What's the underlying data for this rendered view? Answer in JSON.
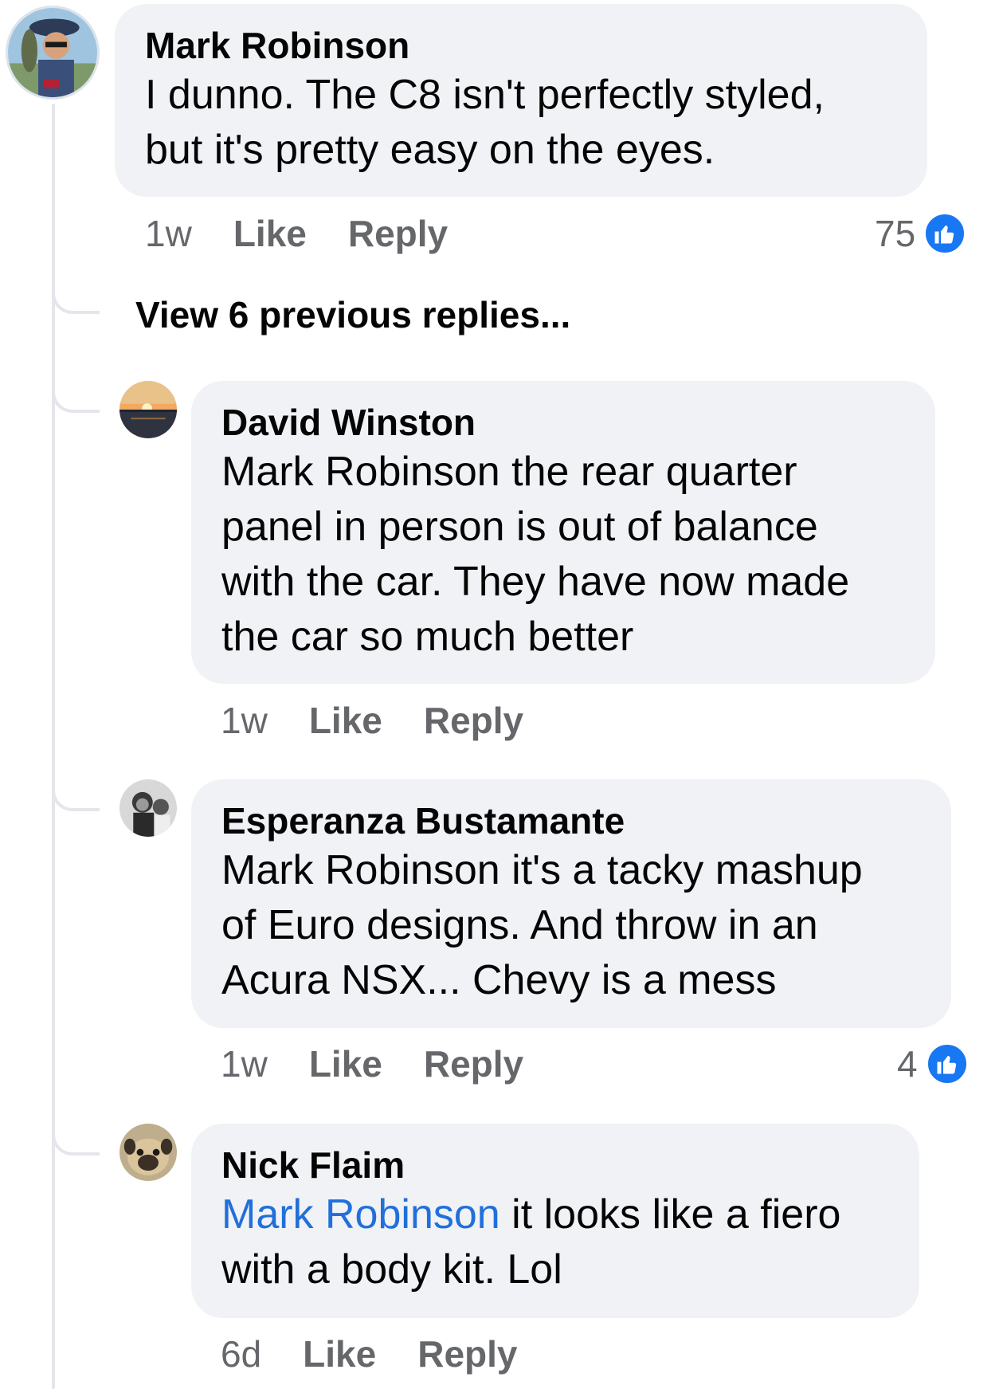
{
  "thread": {
    "view_previous_label": "View 6 previous replies...",
    "comments": [
      {
        "author": "Mark Robinson",
        "lines": [
          "I dunno. The C8 isn't perfectly styled,",
          "but it's pretty easy on the eyes."
        ],
        "time": "1w",
        "like_label": "Like",
        "reply_label": "Reply",
        "reactions": "75"
      },
      {
        "author": "David Winston",
        "lines": [
          "Mark Robinson the rear quarter",
          "panel in person is out of balance",
          "with the car. They have now made",
          "the car so much better"
        ],
        "time": "1w",
        "like_label": "Like",
        "reply_label": "Reply"
      },
      {
        "author": "Esperanza Bustamante",
        "lines": [
          "Mark Robinson it's a tacky mashup",
          "of Euro designs. And throw in an",
          "Acura NSX... Chevy is a mess"
        ],
        "time": "1w",
        "like_label": "Like",
        "reply_label": "Reply",
        "reactions": "4"
      },
      {
        "author": "Nick Flaim",
        "mention": "Mark Robinson",
        "line1_rest": " it looks like a fiero",
        "line2": "with a body kit. Lol",
        "time": "6d",
        "like_label": "Like",
        "reply_label": "Reply"
      }
    ]
  },
  "icons": {
    "reaction": "like-thumbs-up-icon"
  },
  "colors": {
    "bubble": "#f0f2f5",
    "mention": "#216fdb",
    "like_badge": "#1877f2",
    "meta_text": "#65676b"
  }
}
